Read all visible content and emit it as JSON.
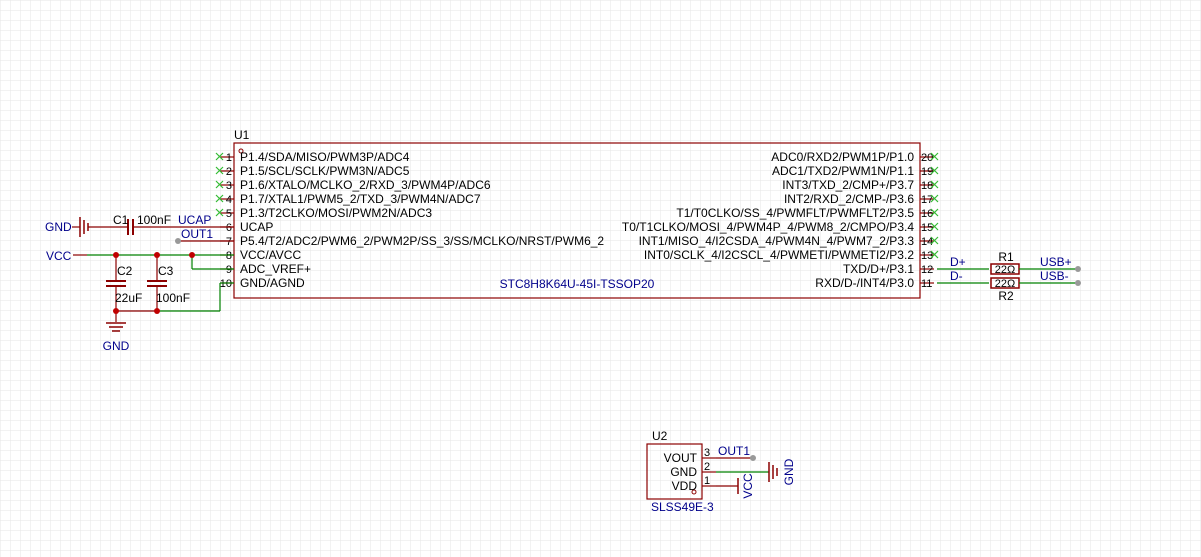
{
  "colors": {
    "grid": "#e6e6e6",
    "body": "#8b0000",
    "pin": "#8b0000",
    "wire": "#008000",
    "junction": "#c00000",
    "text": "#000000",
    "net": "#00008b",
    "noconnect": "#33bb33",
    "port": "#999999"
  },
  "u1": {
    "designator": "U1",
    "part": "STC8H8K64U-45I-TSSOP20",
    "left_pins": [
      {
        "num": "1",
        "name": "P1.4/SDA/MISO/PWM3P/ADC4"
      },
      {
        "num": "2",
        "name": "P1.5/SCL/SCLK/PWM3N/ADC5"
      },
      {
        "num": "3",
        "name": "P1.6/XTALO/MCLKO_2/RXD_3/PWM4P/ADC6"
      },
      {
        "num": "4",
        "name": "P1.7/XTAL1/PWM5_2/TXD_3/PWM4N/ADC7"
      },
      {
        "num": "5",
        "name": "P1.3/T2CLKO/MOSI/PWM2N/ADC3"
      },
      {
        "num": "6",
        "name": "UCAP"
      },
      {
        "num": "7",
        "name": "P5.4/T2/ADC2/PWM6_2/PWM2P/SS_3/SS/MCLKO/NRST/PWM6_2"
      },
      {
        "num": "8",
        "name": "VCC/AVCC"
      },
      {
        "num": "9",
        "name": "ADC_VREF+"
      },
      {
        "num": "10",
        "name": "GND/AGND"
      }
    ],
    "right_pins": [
      {
        "num": "20",
        "name": "ADC0/RXD2/PWM1P/P1.0"
      },
      {
        "num": "19",
        "name": "ADC1/TXD2/PWM1N/P1.1"
      },
      {
        "num": "18",
        "name": "INT3/TXD_2/CMP+/P3.7"
      },
      {
        "num": "17",
        "name": "INT2/RXD_2/CMP-/P3.6"
      },
      {
        "num": "16",
        "name": "T1/T0CLKO/SS_4/PWMFLT/PWMFLT2/P3.5"
      },
      {
        "num": "15",
        "name": "T0/T1CLKO/MOSI_4/PWM4P_4/PWM8_2/CMPO/P3.4"
      },
      {
        "num": "14",
        "name": "INT1/MISO_4/I2CSDA_4/PWM4N_4/PWM7_2/P3.3"
      },
      {
        "num": "13",
        "name": "INT0/SCLK_4/I2CSCL_4/PWMETI/PWMETI2/P3.2"
      },
      {
        "num": "12",
        "name": "TXD/D+/P3.1"
      },
      {
        "num": "11",
        "name": "RXD/D-/INT4/P3.0"
      }
    ]
  },
  "u2": {
    "designator": "U2",
    "part": "SLSS49E-3",
    "pins": [
      {
        "num": "3",
        "name": "VOUT"
      },
      {
        "num": "2",
        "name": "GND"
      },
      {
        "num": "1",
        "name": "VDD"
      }
    ]
  },
  "passives": {
    "c1": {
      "designator": "C1",
      "value": "100nF"
    },
    "c2": {
      "designator": "C2",
      "value": "22uF"
    },
    "c3": {
      "designator": "C3",
      "value": "100nF"
    },
    "r1": {
      "designator": "R1",
      "value": "22Ω"
    },
    "r2": {
      "designator": "R2",
      "value": "22Ω"
    }
  },
  "nets": {
    "gnd": "GND",
    "vcc": "VCC",
    "ucap": "UCAP",
    "out1": "OUT1",
    "dplus": "D+",
    "dminus": "D-",
    "usbp": "USB+",
    "usbm": "USB-"
  }
}
